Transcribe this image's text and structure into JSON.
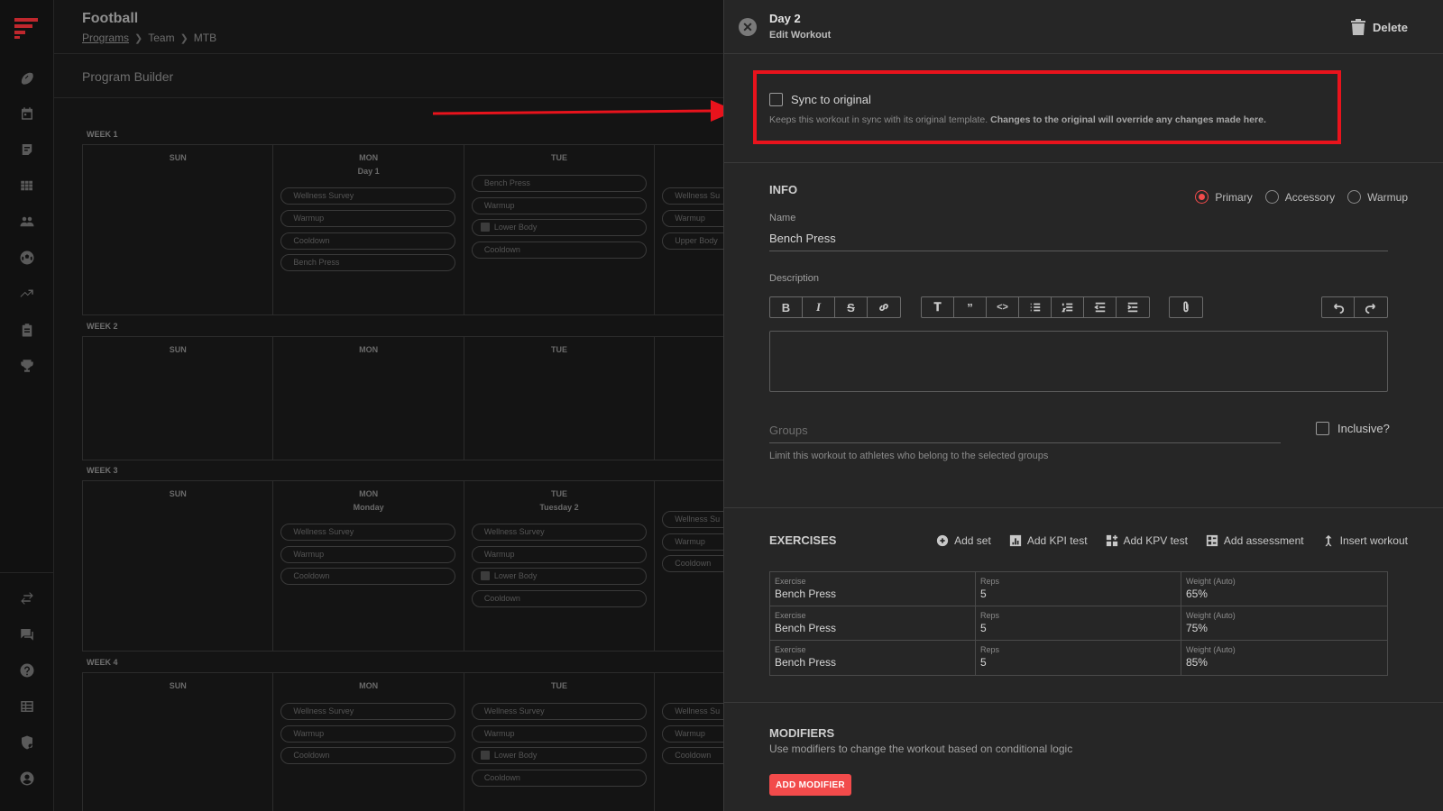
{
  "app": {
    "title": "Football",
    "breadcrumb": [
      "Programs",
      "Team",
      "MTB"
    ],
    "builder_title": "Program Builder",
    "brand_color": "#c0272d"
  },
  "weeks": [
    {
      "label": "WEEK 1",
      "days": [
        {
          "name": "SUN",
          "sub": "",
          "pills": []
        },
        {
          "name": "MON",
          "sub": "Day 1",
          "pills": [
            "Wellness Survey",
            "Warmup",
            "Cooldown",
            "Bench Press"
          ]
        },
        {
          "name": "TUE",
          "sub": "",
          "pills": [
            "Bench Press",
            "Warmup",
            "Lower Body",
            "Cooldown"
          ]
        },
        {
          "name": "",
          "sub": "",
          "pills": [
            "Wellness Su",
            "Warmup",
            "Upper Body"
          ]
        }
      ]
    },
    {
      "label": "WEEK 2",
      "days": [
        {
          "name": "SUN",
          "sub": "",
          "pills": []
        },
        {
          "name": "MON",
          "sub": "",
          "pills": []
        },
        {
          "name": "TUE",
          "sub": "",
          "pills": []
        },
        {
          "name": "",
          "sub": "",
          "pills": []
        }
      ]
    },
    {
      "label": "WEEK 3",
      "days": [
        {
          "name": "SUN",
          "sub": "",
          "pills": []
        },
        {
          "name": "MON",
          "sub": "Monday",
          "pills": [
            "Wellness Survey",
            "Warmup",
            "Cooldown"
          ]
        },
        {
          "name": "TUE",
          "sub": "Tuesday 2",
          "pills": [
            "Wellness Survey",
            "Warmup",
            "Lower Body",
            "Cooldown"
          ]
        },
        {
          "name": "",
          "sub": "",
          "pills": [
            "Wellness Su",
            "Warmup",
            "Cooldown"
          ]
        }
      ]
    },
    {
      "label": "WEEK 4",
      "days": [
        {
          "name": "SUN",
          "sub": "",
          "pills": []
        },
        {
          "name": "MON",
          "sub": "",
          "pills": [
            "Wellness Survey",
            "Warmup",
            "Cooldown"
          ]
        },
        {
          "name": "TUE",
          "sub": "",
          "pills": [
            "Wellness Survey",
            "Warmup",
            "Lower Body",
            "Cooldown"
          ]
        },
        {
          "name": "",
          "sub": "",
          "pills": [
            "Wellness Su",
            "Warmup",
            "Cooldown"
          ]
        }
      ]
    }
  ],
  "drawer": {
    "title": "Day 2",
    "subtitle": "Edit Workout",
    "delete_label": "Delete",
    "sync": {
      "label": "Sync to original",
      "checked": false,
      "desc": "Keeps this workout in sync with its original template. ",
      "desc_bold": "Changes to the original will override any changes made here."
    },
    "info": {
      "title": "INFO",
      "types": [
        "Primary",
        "Accessory",
        "Warmup"
      ],
      "selected_type": "Primary",
      "name_label": "Name",
      "name_value": "Bench Press",
      "description_label": "Description",
      "groups_placeholder": "Groups",
      "groups_help": "Limit this workout to athletes who belong to the selected groups",
      "inclusive_label": "Inclusive?"
    },
    "exercises": {
      "title": "EXERCISES",
      "actions": [
        "Add set",
        "Add KPI test",
        "Add KPV test",
        "Add assessment",
        "Insert workout"
      ],
      "columns": [
        "Exercise",
        "Reps",
        "Weight (Auto)"
      ],
      "rows": [
        [
          "Bench Press",
          "5",
          "65%"
        ],
        [
          "Bench Press",
          "5",
          "75%"
        ],
        [
          "Bench Press",
          "5",
          "85%"
        ]
      ]
    },
    "modifiers": {
      "title": "MODIFIERS",
      "desc": "Use modifiers to change the workout based on conditional logic",
      "add_label": "ADD MODIFIER"
    }
  },
  "colors": {
    "accent": "#f24b4b",
    "highlight": "#e8131c"
  }
}
